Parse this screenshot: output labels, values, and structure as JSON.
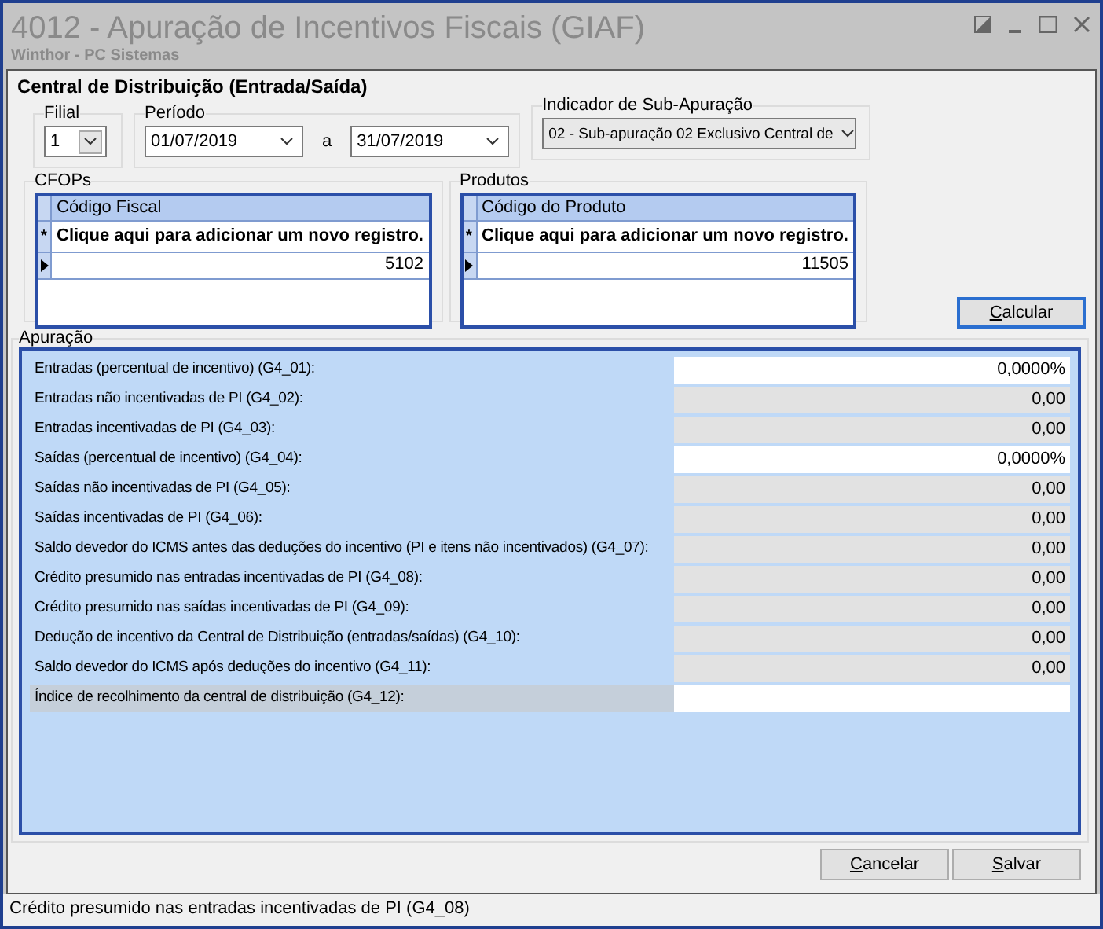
{
  "window": {
    "title": "4012 - Apuração de Incentivos Fiscais (GIAF)",
    "subtitle": "Winthor - PC Sistemas"
  },
  "heading": "Central de Distribuição (Entrada/Saída)",
  "filial": {
    "label": "Filial",
    "value": "1"
  },
  "periodo": {
    "label": "Período",
    "from": "01/07/2019",
    "separator": "a",
    "to": "31/07/2019"
  },
  "sub_apuracao": {
    "label": "Indicador de Sub-Apuração",
    "value": "02 - Sub-apuração 02 Exclusivo Central de"
  },
  "grids": [
    {
      "label": "CFOPs",
      "column": "Código Fiscal",
      "new_row_marker": "*",
      "new_row": "Clique aqui para adicionar um novo registro.",
      "rows": [
        {
          "value": "5102",
          "selected": true
        }
      ]
    },
    {
      "label": "Produtos",
      "column": "Código do Produto",
      "new_row_marker": "*",
      "new_row": "Clique aqui para adicionar um novo registro.",
      "rows": [
        {
          "value": "11505",
          "selected": true
        }
      ]
    }
  ],
  "calc_button": "Calcular",
  "apuracao": {
    "label": "Apuração",
    "rows": [
      {
        "label": "Entradas (percentual de incentivo) (G4_01):",
        "value": "0,0000%",
        "kind": "editable",
        "focused": false
      },
      {
        "label": "Entradas não incentivadas de PI (G4_02):",
        "value": "0,00",
        "kind": "readonly",
        "focused": false
      },
      {
        "label": "Entradas incentivadas de PI (G4_03):",
        "value": "0,00",
        "kind": "readonly",
        "focused": false
      },
      {
        "label": "Saídas (percentual de incentivo) (G4_04):",
        "value": "0,0000%",
        "kind": "editable",
        "focused": false
      },
      {
        "label": "Saídas não incentivadas de PI (G4_05):",
        "value": "0,00",
        "kind": "readonly",
        "focused": false
      },
      {
        "label": "Saídas incentivadas de PI (G4_06):",
        "value": "0,00",
        "kind": "readonly",
        "focused": false
      },
      {
        "label": "Saldo devedor do ICMS antes das deduções do incentivo (PI e itens não incentivados) (G4_07):",
        "value": "0,00",
        "kind": "readonly",
        "focused": false
      },
      {
        "label": "Crédito presumido nas entradas incentivadas de PI (G4_08):",
        "value": "0,00",
        "kind": "readonly",
        "focused": false
      },
      {
        "label": "Crédito presumido nas saídas incentivadas de PI (G4_09):",
        "value": "0,00",
        "kind": "readonly",
        "focused": false
      },
      {
        "label": "Dedução de incentivo da Central de Distribuição (entradas/saídas) (G4_10):",
        "value": "0,00",
        "kind": "readonly",
        "focused": false
      },
      {
        "label": "Saldo devedor do ICMS após deduções do incentivo (G4_11):",
        "value": "0,00",
        "kind": "readonly",
        "focused": false
      },
      {
        "label": "Índice de recolhimento da central de distribuição (G4_12):",
        "kind": "editable",
        "focused": true
      }
    ]
  },
  "buttons": [
    "Cancelar",
    "Salvar"
  ],
  "status_bar": "Crédito presumido nas entradas incentivadas de PI (G4_08)"
}
